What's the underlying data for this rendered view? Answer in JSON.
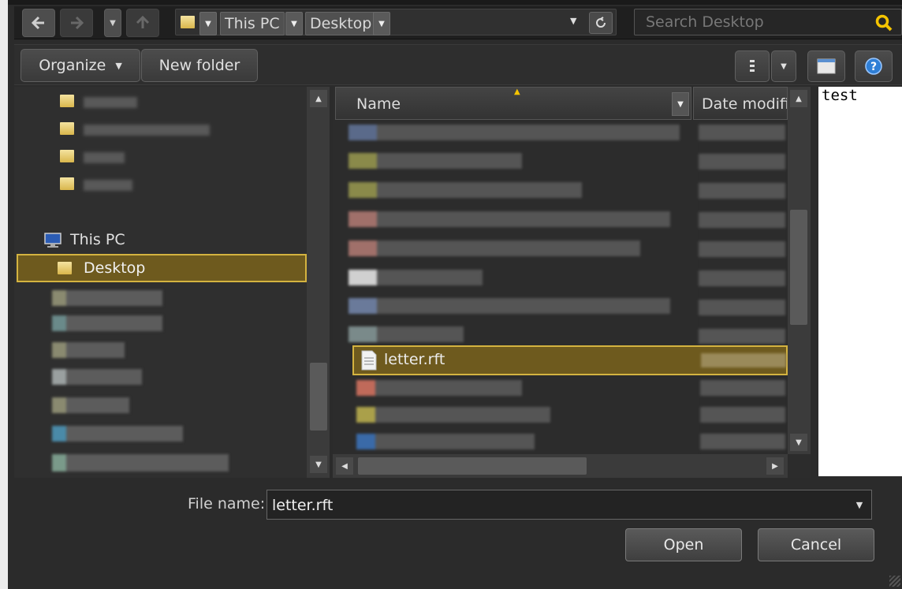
{
  "nav": {
    "breadcrumbs": [
      "This PC",
      "Desktop"
    ],
    "search_placeholder": "Search Desktop"
  },
  "toolbar": {
    "organize_label": "Organize",
    "new_folder_label": "New folder"
  },
  "sidebar": {
    "this_pc_label": "This PC",
    "selected_label": "Desktop"
  },
  "file_list": {
    "columns": {
      "name": "Name",
      "date": "Date modifie"
    },
    "selected_file": "letter.rft"
  },
  "preview": {
    "text": "test"
  },
  "footer": {
    "file_name_label": "File name:",
    "file_name_value": "letter.rft",
    "open_label": "Open",
    "cancel_label": "Cancel"
  },
  "colors": {
    "accent_selection": "#6e5a1e",
    "selection_border": "#d4b340",
    "search_icon": "#f5c400",
    "help_icon": "#2f7fd6"
  }
}
